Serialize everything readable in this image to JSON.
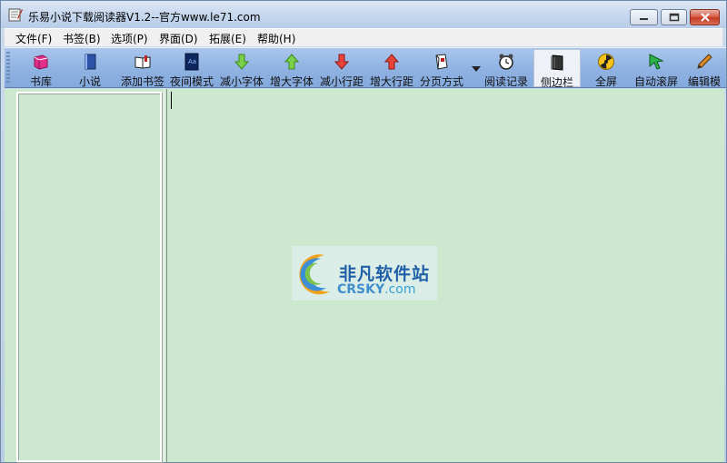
{
  "window": {
    "title": "乐易小说下载阅读器V1.2--官方www.le71.com"
  },
  "menu": [
    {
      "label": "文件(F)"
    },
    {
      "label": "书签(B)"
    },
    {
      "label": "选项(P)"
    },
    {
      "label": "界面(D)"
    },
    {
      "label": "拓展(E)"
    },
    {
      "label": "帮助(H)"
    }
  ],
  "toolbar": [
    {
      "label": "书库",
      "icon": "bookshelf-icon"
    },
    {
      "label": "小说",
      "icon": "novel-icon"
    },
    {
      "label": "添加书签",
      "icon": "add-bookmark-icon"
    },
    {
      "label": "夜间模式",
      "icon": "night-mode-icon"
    },
    {
      "label": "减小字体",
      "icon": "arrow-down-green-icon"
    },
    {
      "label": "增大字体",
      "icon": "arrow-up-green-icon"
    },
    {
      "label": "减小行距",
      "icon": "arrow-down-red-icon"
    },
    {
      "label": "增大行距",
      "icon": "arrow-up-red-icon"
    },
    {
      "label": "分页方式",
      "icon": "page-mode-icon"
    },
    {
      "label": "阅读记录",
      "icon": "alarm-clock-icon"
    },
    {
      "label": "侧边栏",
      "icon": "sidebar-book-icon",
      "active": true
    },
    {
      "label": "全屏",
      "icon": "radiation-icon"
    },
    {
      "label": "自动滚屏",
      "icon": "cursor-arrow-icon"
    },
    {
      "label": "编辑模",
      "icon": "pencil-icon"
    }
  ],
  "watermark": {
    "cn": "非凡软件站",
    "en_main": "CRSKY",
    "en_suffix": ".com"
  },
  "colors": {
    "reader_bg": "#cce8cf",
    "toolbar_bg": "#8fb2e2",
    "menu_bg": "#f0f0f0"
  }
}
